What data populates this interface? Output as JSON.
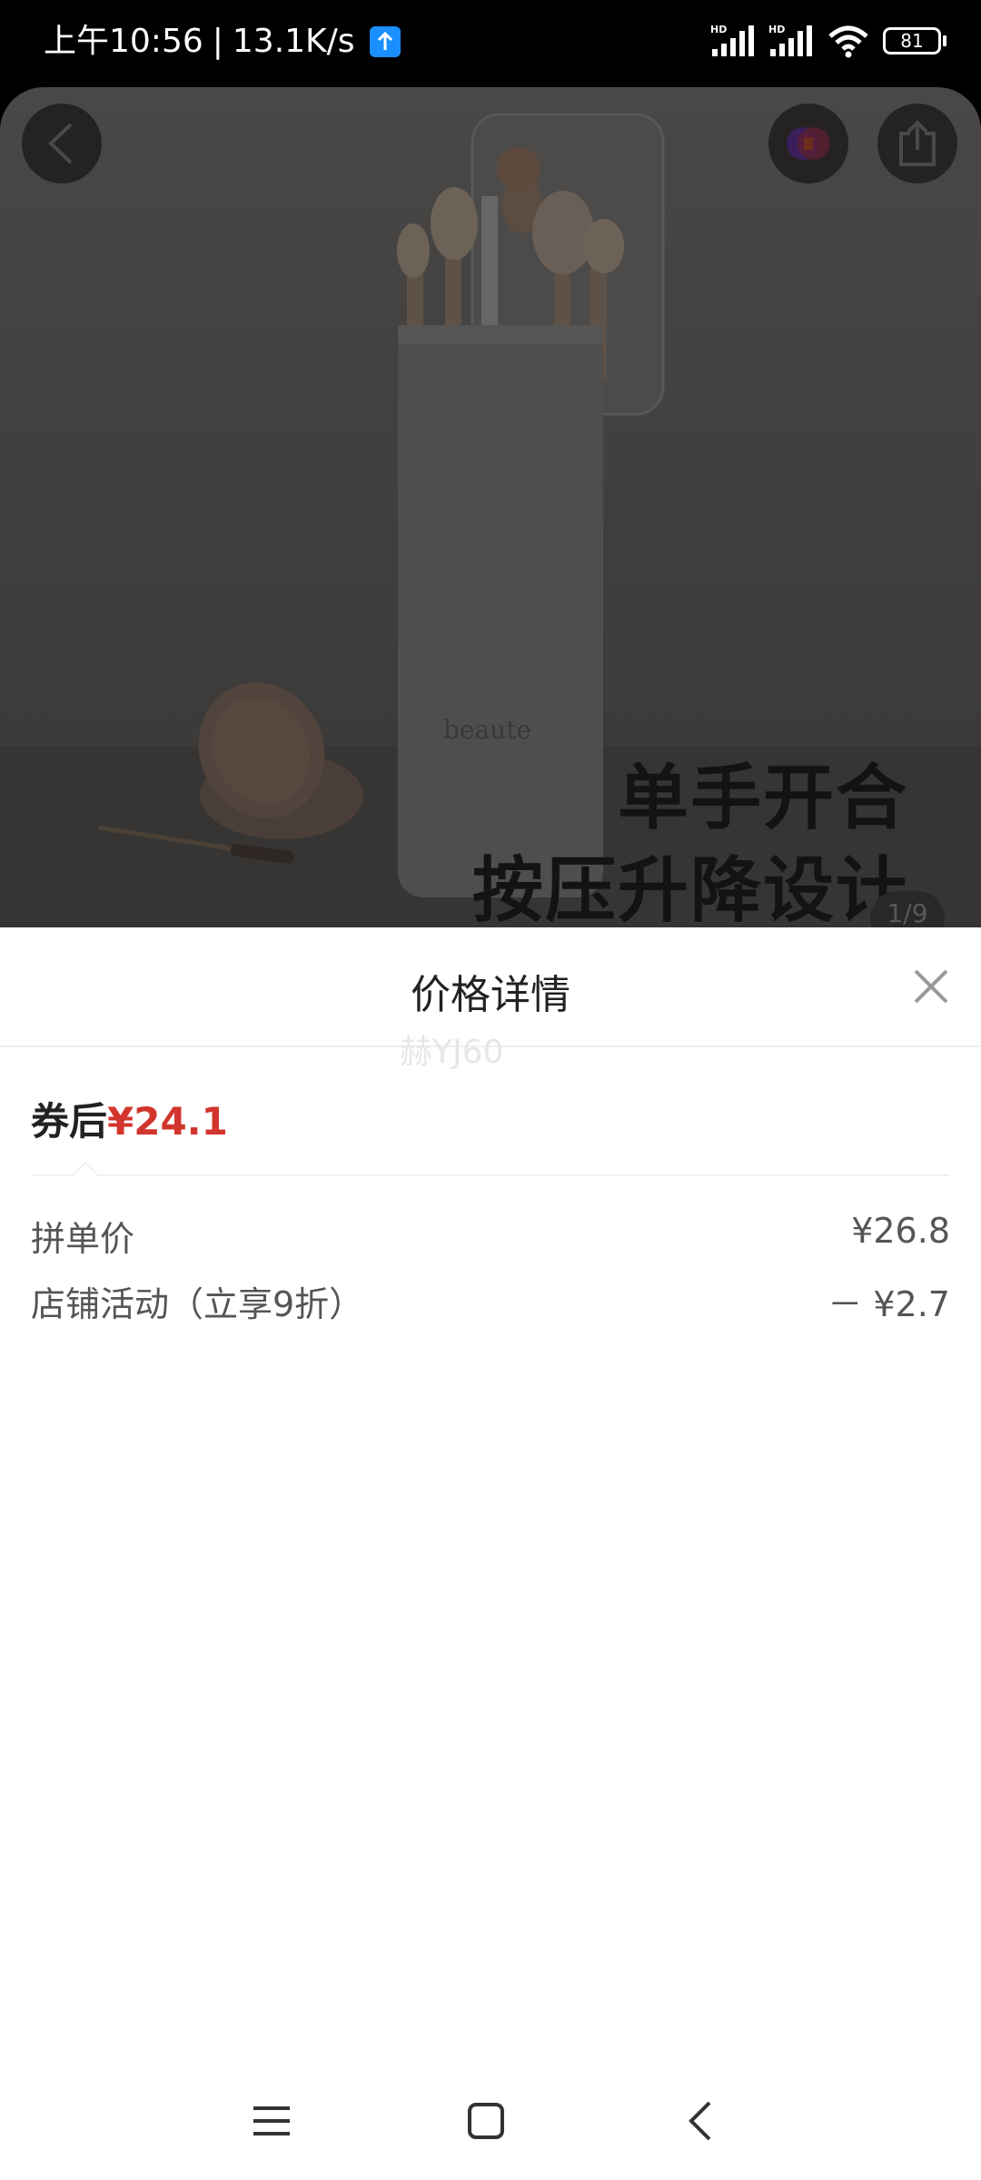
{
  "status_bar": {
    "time": "上午10:56",
    "separator": "|",
    "speed": "13.1K/s",
    "battery": "81",
    "icons": [
      "upload-badge-icon",
      "hd-signal-icon",
      "hd-signal-icon",
      "wifi-icon",
      "battery-icon"
    ]
  },
  "hero": {
    "brand_text": "beaute",
    "line1": "单手开合",
    "line2": "按压升降设计",
    "page_indicator": "1/9"
  },
  "sheet": {
    "title": "价格详情",
    "watermark": "赫YJ60",
    "final_label": "券后",
    "final_price": "¥24.1",
    "rows": [
      {
        "label": "拼单价",
        "value": "¥26.8"
      },
      {
        "label": "店铺活动（立享9折）",
        "value": "－ ¥2.7"
      }
    ]
  },
  "colors": {
    "accent_red": "#d2352d",
    "upload_blue": "#1a8fff"
  }
}
